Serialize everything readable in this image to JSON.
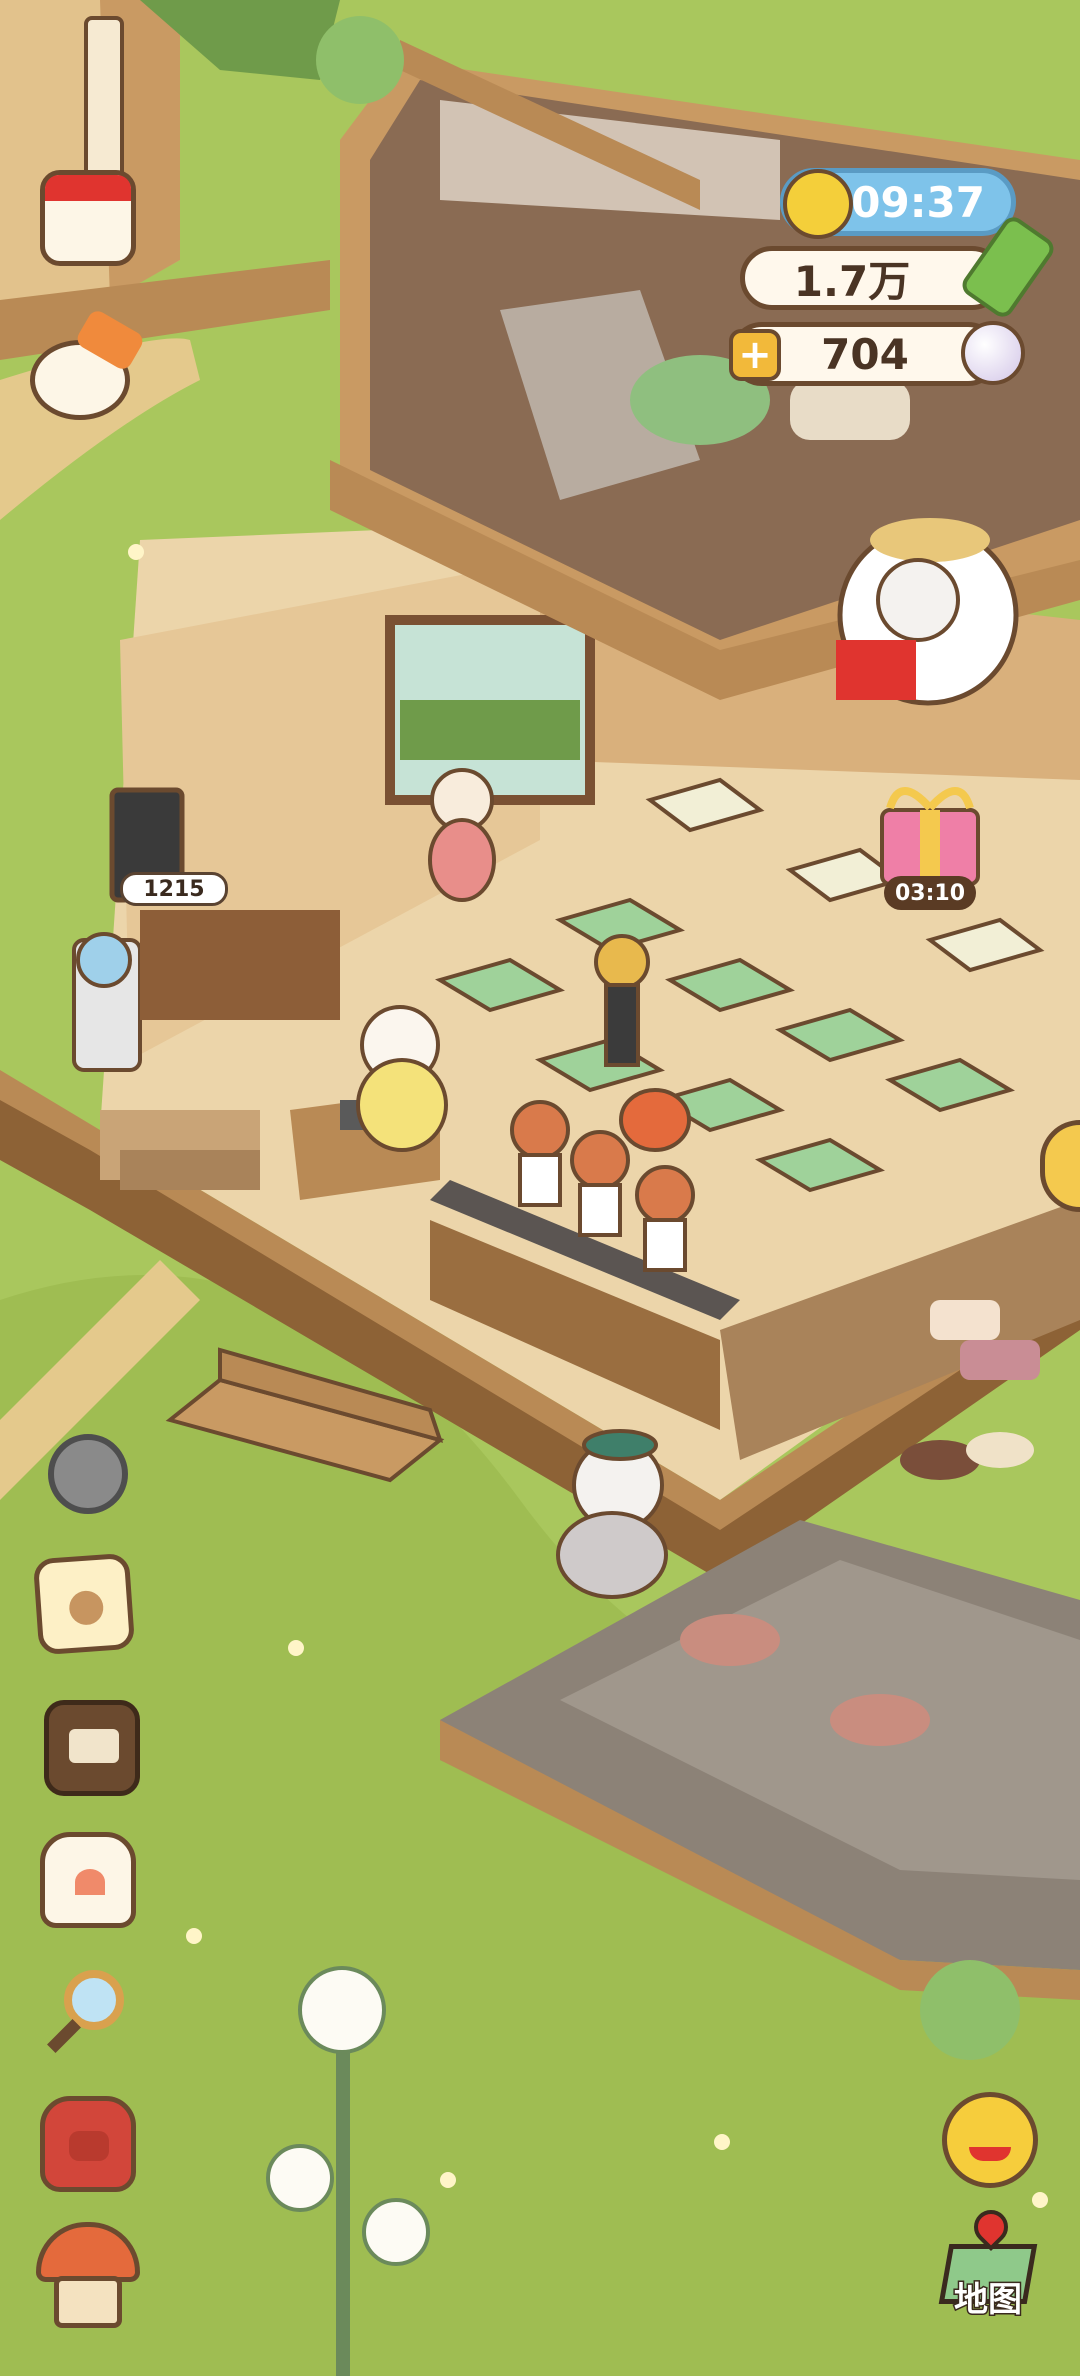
{
  "hud": {
    "clock_time": "09:37",
    "coins": "1.7万",
    "gems": "704"
  },
  "scene": {
    "board_number": "1215",
    "gift_timer": "03:10"
  },
  "buttons": {
    "map_label": "地图"
  },
  "icons": {
    "left_top": [
      "calendar-icon",
      "paint-palette-icon"
    ],
    "left_bottom": [
      "settings-gear-icon",
      "gift-card-icon",
      "recipe-book-icon",
      "shirt-icon",
      "magnifier-icon",
      "backpack-icon",
      "mushroom-house-icon"
    ],
    "right": [
      "emoji-face-icon",
      "map-icon"
    ]
  },
  "colors": {
    "grass": "#a9c75d",
    "wood": "#c99a63",
    "floor": "#ecd5aa",
    "table_cloth": "#9fd29a",
    "hud_outline": "#6b4a2f",
    "sky_blue": "#7ec3ea"
  }
}
